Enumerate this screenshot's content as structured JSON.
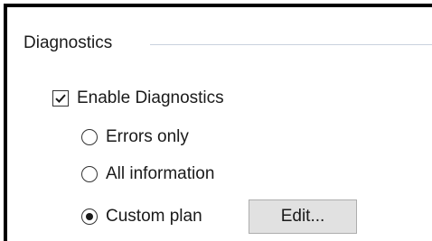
{
  "group": {
    "title": "Diagnostics"
  },
  "enable_checkbox": {
    "label": "Enable Diagnostics",
    "checked": true
  },
  "options": [
    {
      "label": "Errors only",
      "selected": false
    },
    {
      "label": "All information",
      "selected": false
    },
    {
      "label": "Custom plan",
      "selected": true
    }
  ],
  "edit_button": {
    "label": "Edit..."
  }
}
